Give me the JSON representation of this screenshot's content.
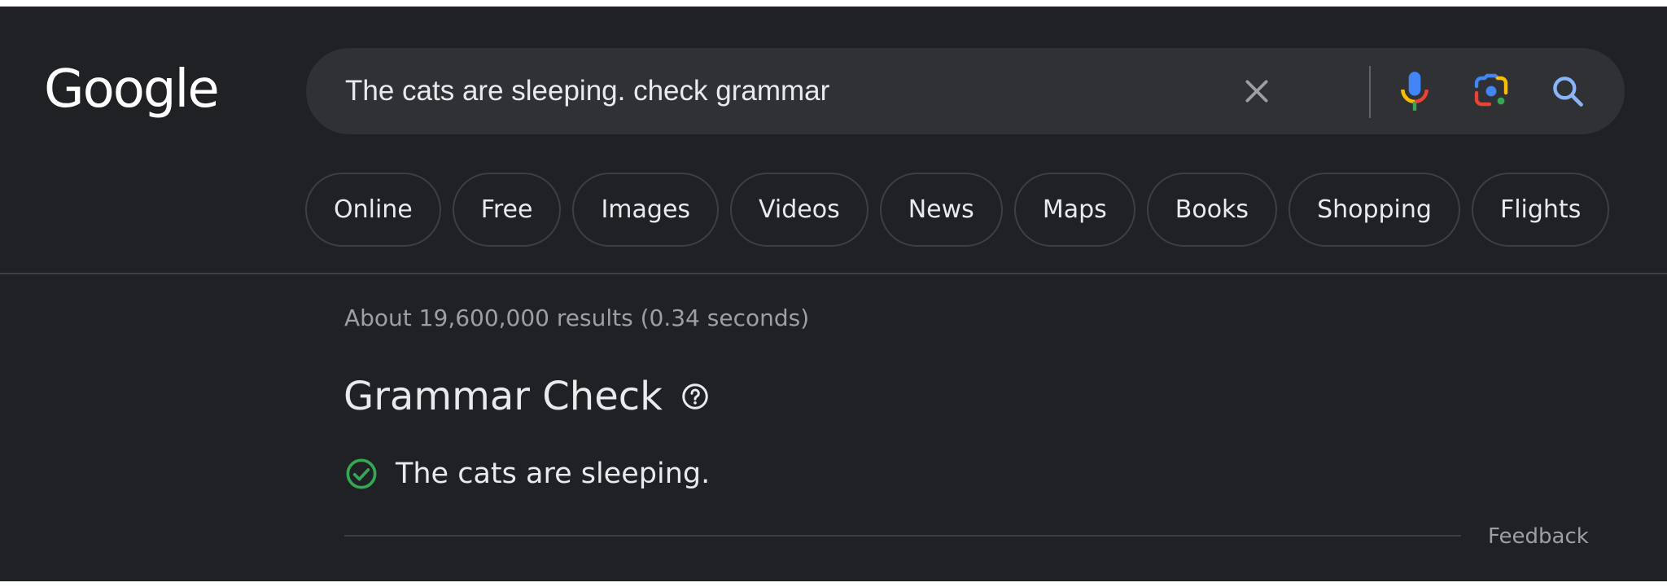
{
  "header": {
    "logo_text": "Google",
    "search": {
      "value": "The cats are sleeping. check grammar",
      "clear_icon": "close-icon",
      "voice_icon": "microphone-icon",
      "lens_icon": "google-lens-icon",
      "search_icon": "search-icon"
    }
  },
  "chips": [
    {
      "label": "Online"
    },
    {
      "label": "Free"
    },
    {
      "label": "Images"
    },
    {
      "label": "Videos"
    },
    {
      "label": "News"
    },
    {
      "label": "Maps"
    },
    {
      "label": "Books"
    },
    {
      "label": "Shopping"
    },
    {
      "label": "Flights"
    }
  ],
  "results": {
    "stats": "About 19,600,000 results (0.34 seconds)",
    "grammar_check": {
      "title": "Grammar Check",
      "help_icon": "help-circle-icon",
      "status_icon": "check-circle-icon",
      "corrected_text": "The cats are sleeping."
    },
    "feedback_label": "Feedback"
  },
  "colors": {
    "background": "#202124",
    "searchbox": "#303134",
    "text_primary": "#e8eaed",
    "text_secondary": "#9aa0a6",
    "border": "#3c4043",
    "check_green": "#34a853",
    "google_blue": "#4285f4",
    "google_red": "#ea4335",
    "google_yellow": "#fbbc04",
    "google_green": "#34a853",
    "search_icon_blue": "#8ab4f8"
  }
}
